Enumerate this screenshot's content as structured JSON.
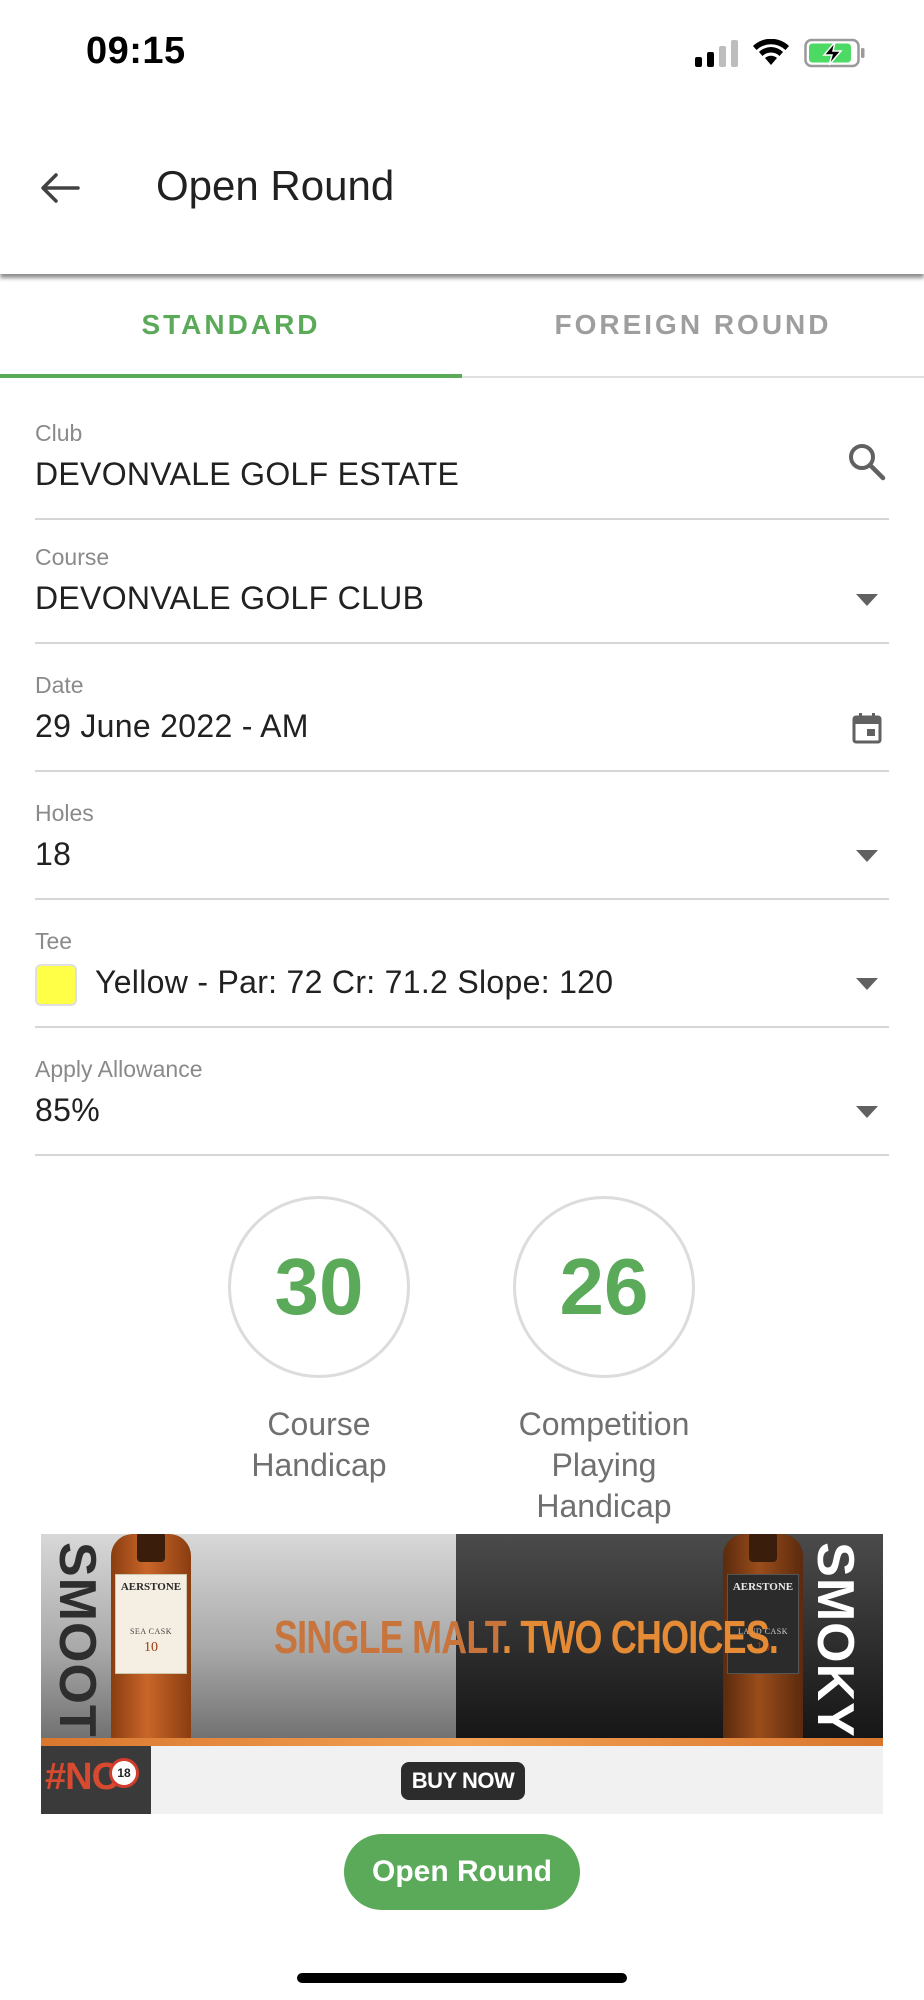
{
  "status_bar": {
    "time": "09:15",
    "icons": [
      "signal-icon",
      "wifi-icon",
      "battery-charging-icon"
    ],
    "battery_color": "#4cd964"
  },
  "header": {
    "back_icon": "arrow-left-icon",
    "title": "Open Round"
  },
  "tabs": [
    {
      "label": "STANDARD",
      "active": true
    },
    {
      "label": "FOREIGN ROUND",
      "active": false
    }
  ],
  "form": {
    "club": {
      "label": "Club",
      "value": "DEVONVALE GOLF ESTATE",
      "icon": "search-icon"
    },
    "course": {
      "label": "Course",
      "value": "DEVONVALE GOLF CLUB",
      "icon": "dropdown-arrow-icon"
    },
    "date": {
      "label": "Date",
      "value": "29 June 2022 - AM",
      "icon": "calendar-icon"
    },
    "holes": {
      "label": "Holes",
      "value": "18",
      "icon": "dropdown-arrow-icon"
    },
    "tee": {
      "label": "Tee",
      "value": "Yellow - Par: 72 Cr: 71.2 Slope: 120",
      "swatch_color": "#ffff47",
      "icon": "dropdown-arrow-icon"
    },
    "allowance": {
      "label": "Apply Allowance",
      "value": "85%",
      "icon": "dropdown-arrow-icon"
    }
  },
  "handicaps": {
    "course": {
      "value": "30",
      "label_lines": [
        "Course",
        "Handicap"
      ]
    },
    "competition": {
      "value": "26",
      "label_lines": [
        "Competition",
        "Playing",
        "Handicap"
      ]
    }
  },
  "ad": {
    "left_vertical": "SMOOTH",
    "right_vertical": "SMOKY",
    "tagline_part1": "SINGLE MALT",
    "tagline_dot": ".",
    "tagline_part2": " TWO CHOICES.",
    "bottle_brand": "AERSTONE",
    "bottle_left_cask": "SEA CASK",
    "bottle_right_cask": "LAND CASK",
    "bottle_age": "10",
    "logo_text": "#NO",
    "logo_badge": "18",
    "cta": "BUY NOW"
  },
  "primary_button": {
    "label": "Open Round"
  },
  "colors": {
    "accent": "#5aaa5a",
    "inactive_tab": "#9e9e9e",
    "label": "#8a8a8a"
  }
}
